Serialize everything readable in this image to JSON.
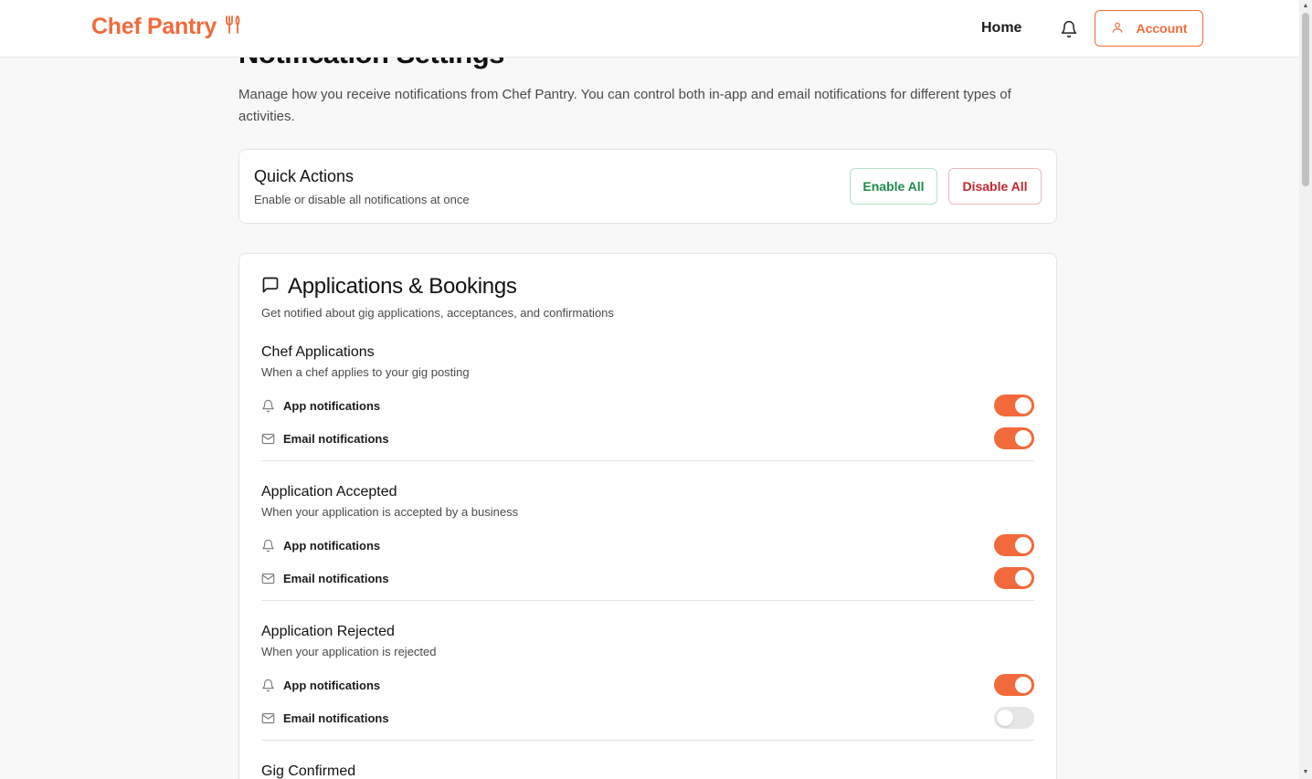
{
  "header": {
    "brand": "Chef Pantry",
    "nav_home": "Home",
    "account_label": "Account",
    "accent_color": "#f26a3b"
  },
  "page": {
    "title": "Notification Settings",
    "description": "Manage how you receive notifications from Chef Pantry. You can control both in-app and email notifications for different types of activities."
  },
  "quick_actions": {
    "title": "Quick Actions",
    "subtitle": "Enable or disable all notifications at once",
    "enable_label": "Enable All",
    "disable_label": "Disable All"
  },
  "section": {
    "icon": "message-square-icon",
    "title": "Applications & Bookings",
    "subtitle": "Get notified about gig applications, acceptances, and confirmations",
    "app_label": "App notifications",
    "email_label": "Email notifications",
    "groups": [
      {
        "title": "Chef Applications",
        "subtitle": "When a chef applies to your gig posting",
        "app_enabled": true,
        "email_enabled": true
      },
      {
        "title": "Application Accepted",
        "subtitle": "When your application is accepted by a business",
        "app_enabled": true,
        "email_enabled": true
      },
      {
        "title": "Application Rejected",
        "subtitle": "When your application is rejected",
        "app_enabled": true,
        "email_enabled": false
      },
      {
        "title": "Gig Confirmed"
      }
    ]
  }
}
